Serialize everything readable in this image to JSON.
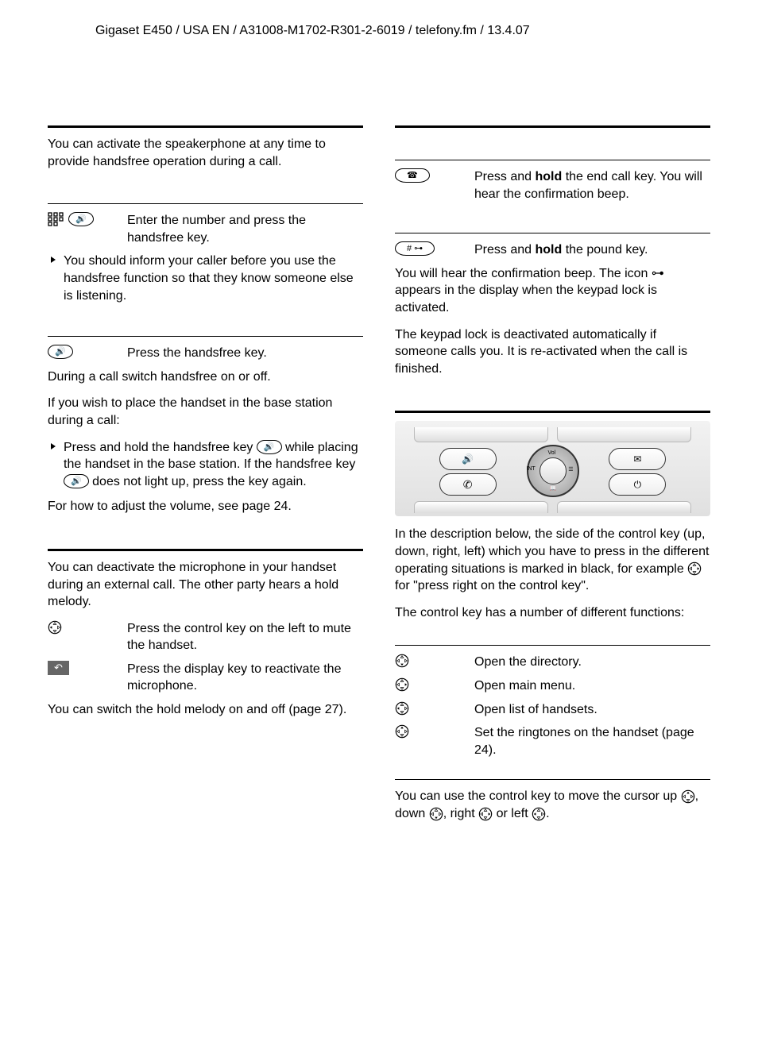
{
  "header": "Gigaset E450 / USA EN / A31008-M1702-R301-2-6019 / telefony.fm / 13.4.07",
  "left": {
    "intro": "You can activate the speakerphone at any time to provide handsfree operation during a call.",
    "step_enter": "Enter the number and press the handsfree key.",
    "inform_note": "You should inform your caller before you use the handsfree function so that they know someone else is listening.",
    "press_handsfree": "Press the handsfree key.",
    "during_call": "During a call switch handsfree on or off.",
    "place_in_base_intro": "If you wish to place the handset in the base station during a call:",
    "place_in_base_step_a": "Press and hold the handsfree key ",
    "place_in_base_step_b": " while placing the handset in the base station. If the handsfree key ",
    "place_in_base_step_c": " does not light up, press the key again.",
    "volume_ref": "For how to adjust the volume, see page 24.",
    "mute_intro": "You can deactivate the microphone in your handset during an external call. The other party hears a hold melody.",
    "mute_step": "Press the control key on the left to mute the handset.",
    "unmute_step": "Press the display key to reactivate the microphone.",
    "hold_melody_ref": "You can switch the hold melody on and off (page 27)."
  },
  "right": {
    "endcall_a": "Press and ",
    "endcall_bold": "hold",
    "endcall_b": " the end call key. You will hear the confirmation beep.",
    "pound_a": "Press and ",
    "pound_bold": "hold",
    "pound_b": " the pound key.",
    "lock_confirm": "You will hear the confirmation beep. The icon ⊶ appears in the display when the keypad lock is activated.",
    "lock_auto": "The keypad lock is deactivated automatically if someone calls you. It is re-activated when the call is finished.",
    "nav": {
      "vol": "Vol",
      "int": "INT"
    },
    "ctrl_desc_a": "In the description below, the side of the control key (up, down, right, left) which you have to press in the different operating situations is marked in black, for example ",
    "ctrl_desc_b": " for \"press right on the control key\".",
    "ctrl_functions_intro": "The control key has a number of different functions:",
    "fn_down": "Open the directory.",
    "fn_right": "Open main menu.",
    "fn_left": "Open list of handsets.",
    "fn_up": "Set the ringtones on the handset (page 24).",
    "cursor_a": "You can use the control key to move the cursor up ",
    "cursor_b": ", down ",
    "cursor_c": ", right ",
    "cursor_d": " or left ",
    "cursor_e": "."
  },
  "icons": {
    "handsfree": "🔊",
    "endcall": "☎",
    "pound": "# ⊶",
    "envelope": "✉",
    "talk": "✆",
    "power": "⏻",
    "undo": "↶",
    "book": "📖"
  }
}
